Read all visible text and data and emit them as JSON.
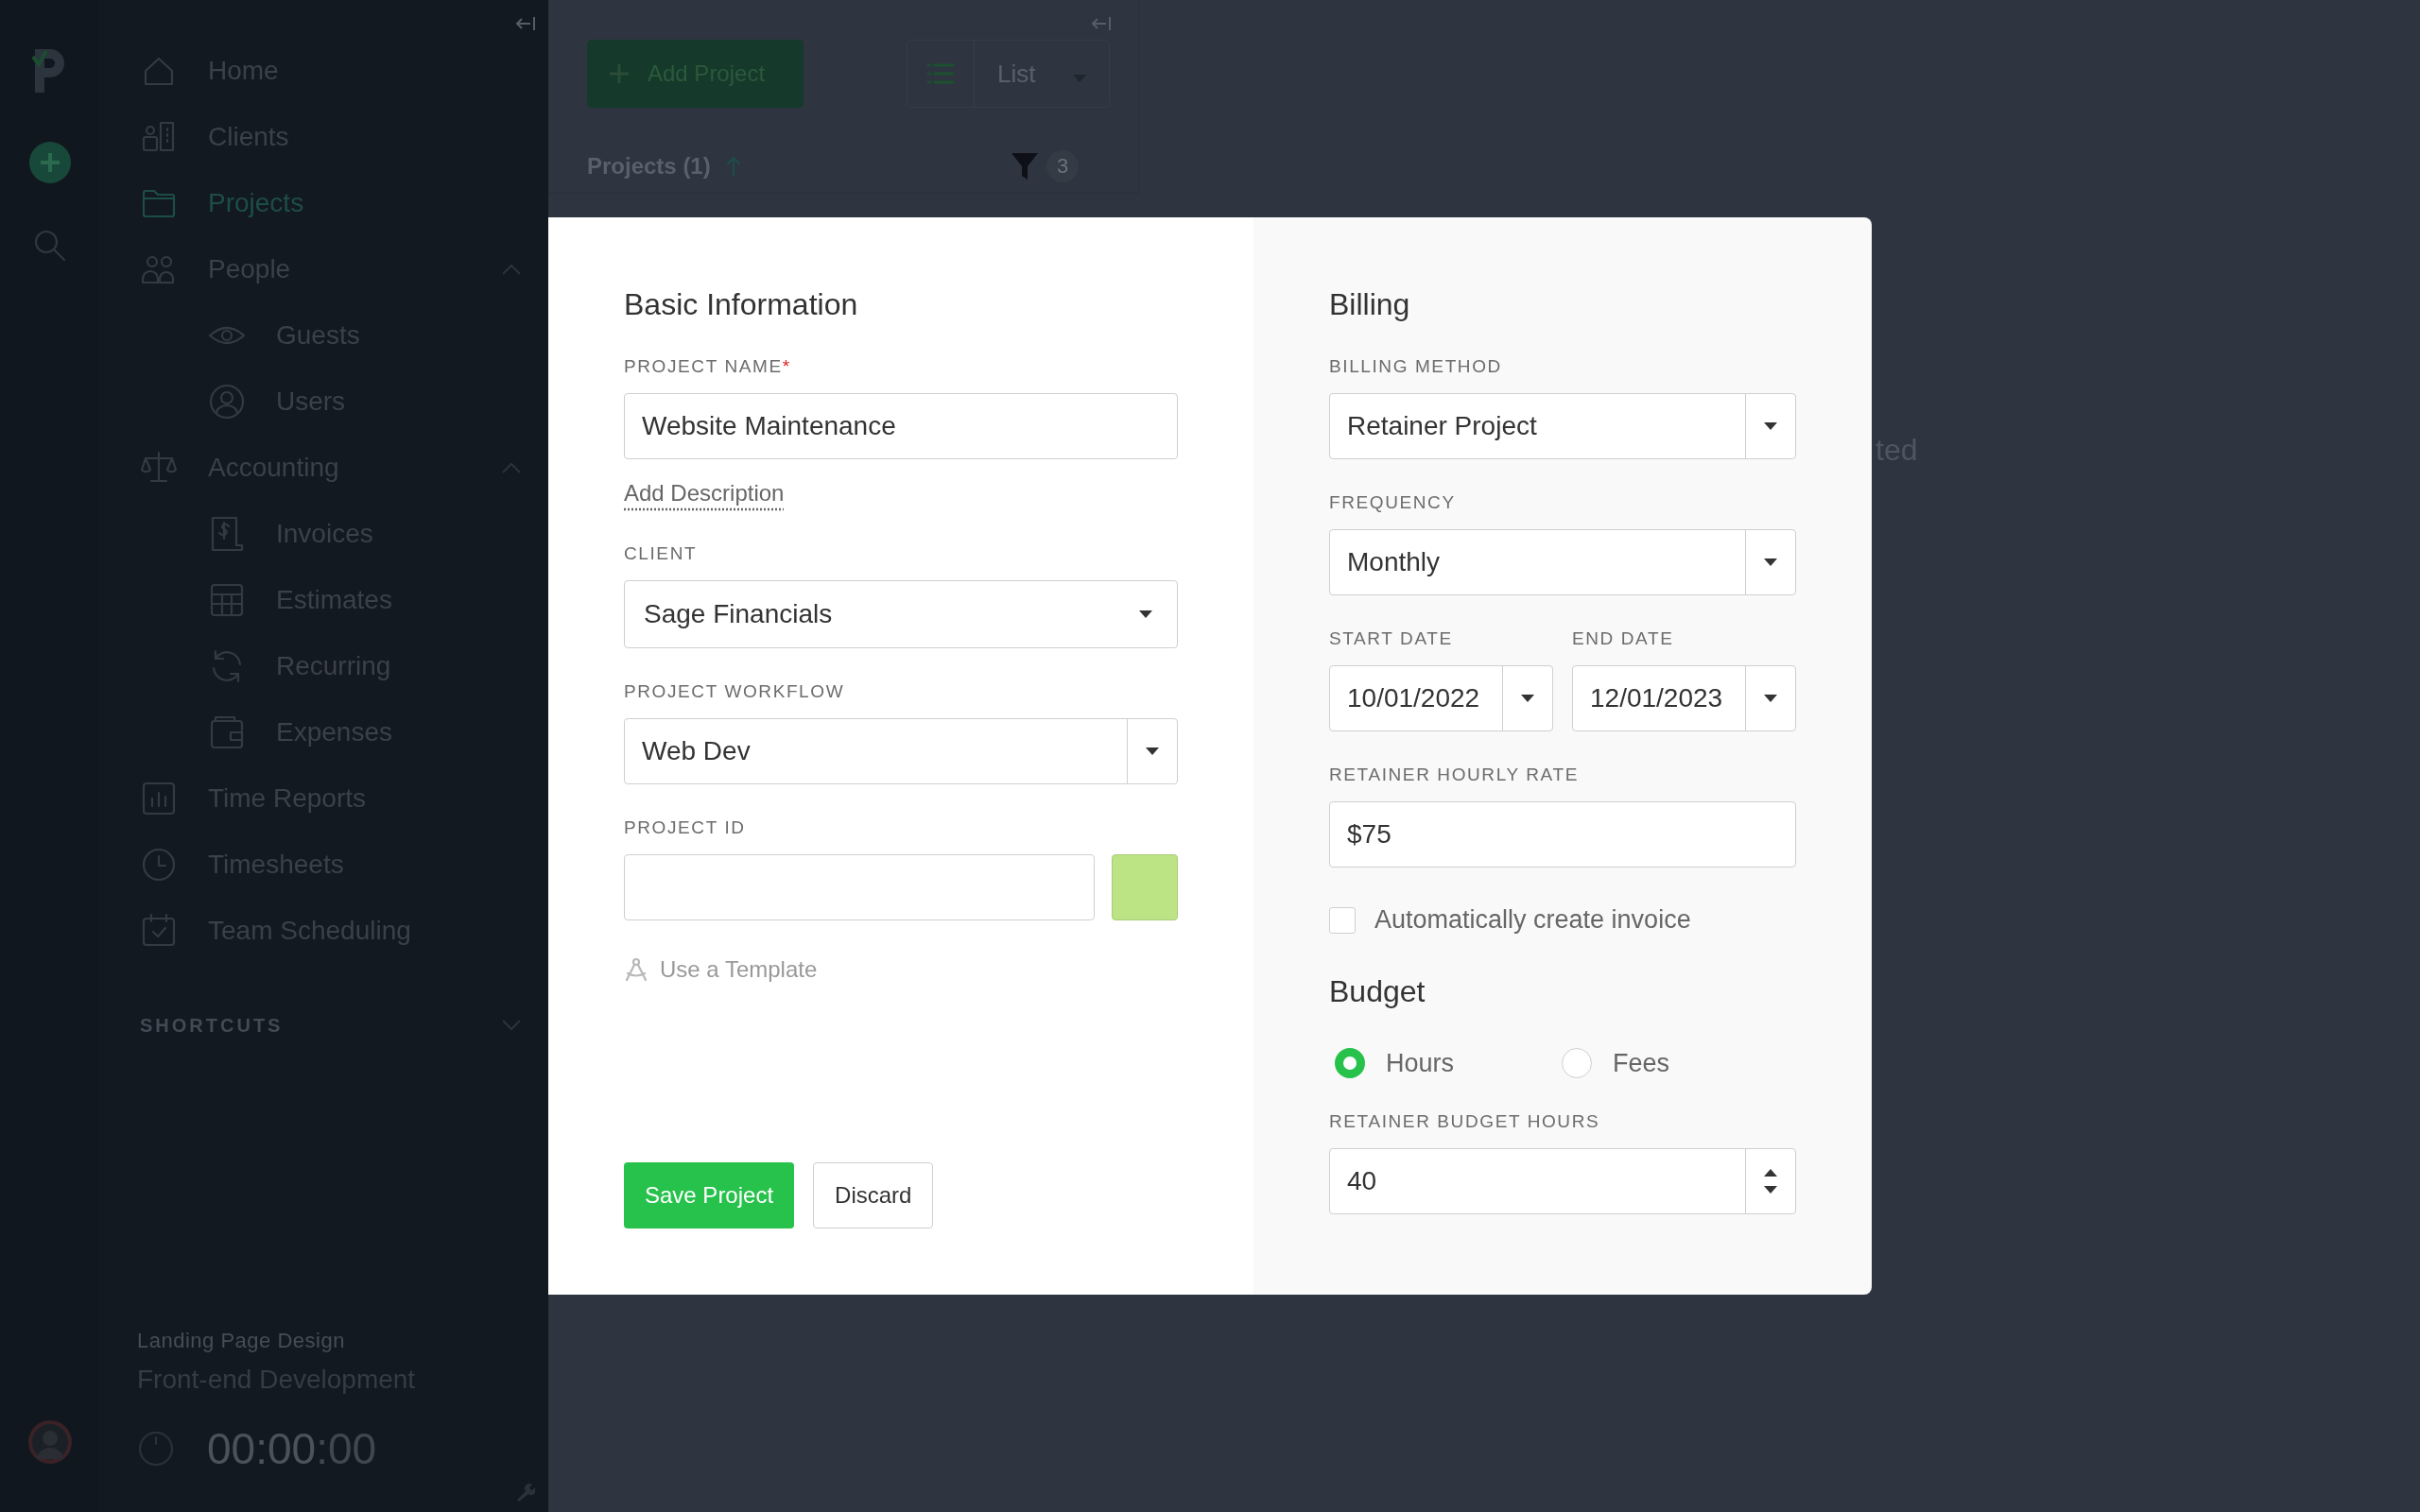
{
  "sidebar": {
    "items": [
      {
        "label": "Home",
        "selected": false
      },
      {
        "label": "Clients",
        "selected": false
      },
      {
        "label": "Projects",
        "selected": true
      },
      {
        "label": "People",
        "selected": false,
        "expanded": true,
        "children": [
          {
            "label": "Guests",
            "selected": false
          },
          {
            "label": "Users",
            "selected": false
          }
        ]
      },
      {
        "label": "Accounting",
        "selected": false,
        "expanded": true,
        "children": [
          {
            "label": "Invoices",
            "selected": false
          },
          {
            "label": "Estimates",
            "selected": false
          },
          {
            "label": "Recurring",
            "selected": false
          },
          {
            "label": "Expenses",
            "selected": false
          }
        ]
      },
      {
        "label": "Time Reports",
        "selected": false
      },
      {
        "label": "Timesheets",
        "selected": false
      },
      {
        "label": "Team Scheduling",
        "selected": false
      }
    ],
    "shortcuts": {
      "label": "SHORTCUTS",
      "expanded": false
    },
    "timer": {
      "project": "Landing Page Design",
      "task": "Front-end Development",
      "time": "00:00",
      "seconds": ":00"
    }
  },
  "toolbar": {
    "add_button": "Add Project",
    "view": "List",
    "projects_label": "Projects (1)",
    "filter_count": "3"
  },
  "background_text": "ted",
  "modal": {
    "basic": {
      "title": "Basic Information",
      "project_name": {
        "label": "PROJECT NAME",
        "required_mark": "*",
        "value": "Website Maintenance"
      },
      "add_description": "Add Description",
      "client": {
        "label": "CLIENT",
        "value": "Sage Financials"
      },
      "workflow": {
        "label": "PROJECT WORKFLOW",
        "value": "Web Dev"
      },
      "project_id": {
        "label": "PROJECT ID",
        "color": "#bce484"
      },
      "template": "Use a Template",
      "buttons": [
        {
          "label": "Save Project",
          "kind": "primary"
        },
        {
          "label": "Discard",
          "kind": "secondary"
        }
      ]
    },
    "billing": {
      "title": "Billing",
      "method": {
        "label": "BILLING METHOD",
        "value": "Retainer Project"
      },
      "frequency": {
        "label": "FREQUENCY",
        "value": "Monthly"
      },
      "start_date": {
        "label": "START DATE",
        "value": "10/01/2022"
      },
      "end_date": {
        "label": "END DATE",
        "value": "12/01/2023"
      },
      "rate": {
        "label": "RETAINER HOURLY RATE",
        "value": "$75"
      },
      "auto_invoice": {
        "label": "Automatically create invoice",
        "checked": false
      }
    },
    "budget": {
      "title": "Budget",
      "options": [
        {
          "label": "Hours",
          "selected": true
        },
        {
          "label": "Fees",
          "selected": false
        }
      ],
      "hours": {
        "label": "RETAINER BUDGET HOURS",
        "value": "40"
      }
    }
  }
}
